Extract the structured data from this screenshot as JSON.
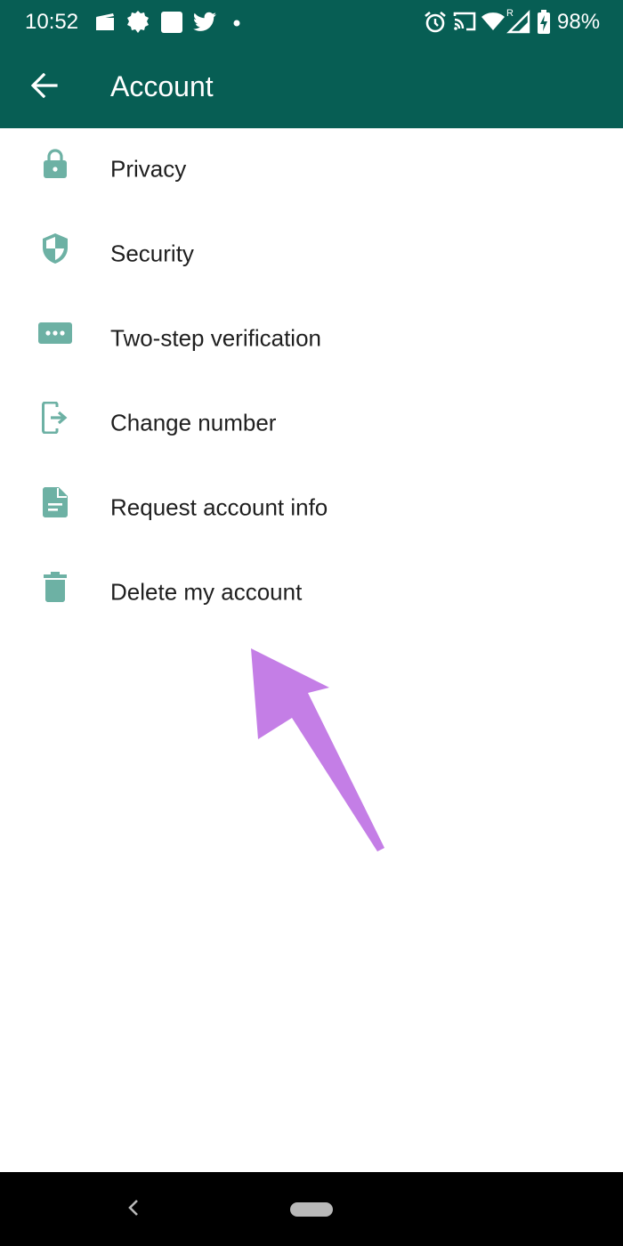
{
  "status_bar": {
    "time": "10:52",
    "battery": "98%",
    "icons": [
      "media-icon",
      "settings-notification-icon",
      "square-notification-icon",
      "twitter-icon",
      "dot-icon",
      "alarm-icon",
      "cast-icon",
      "wifi-icon",
      "signal-roaming-icon",
      "battery-charging-icon"
    ]
  },
  "app_bar": {
    "title": "Account",
    "back_icon": "arrow-back-icon",
    "color": "#075e54"
  },
  "menu": {
    "icon_color": "#6db1a4",
    "items": [
      {
        "label": "Privacy",
        "icon": "lock-icon"
      },
      {
        "label": "Security",
        "icon": "shield-icon"
      },
      {
        "label": "Two-step verification",
        "icon": "password-dots-icon"
      },
      {
        "label": "Change number",
        "icon": "change-number-icon"
      },
      {
        "label": "Request account info",
        "icon": "document-icon"
      },
      {
        "label": "Delete my account",
        "icon": "trash-icon"
      }
    ]
  },
  "annotation": {
    "color": "#c47ee6"
  }
}
